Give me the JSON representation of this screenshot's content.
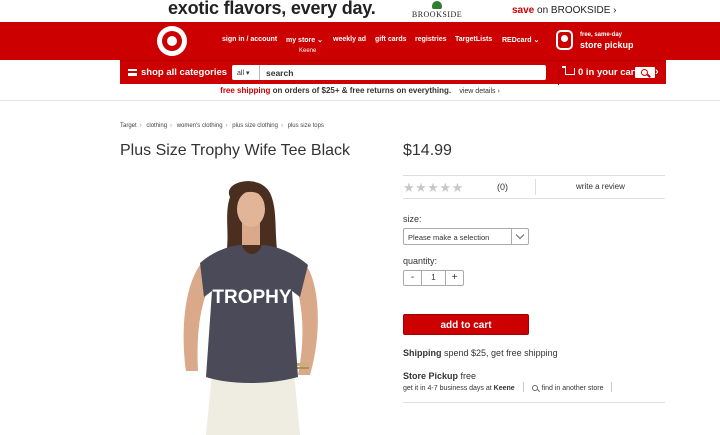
{
  "promo": {
    "tagline": "exotic flavors, every day.",
    "logo_text": "BROOKSIDE",
    "cta_save": "save",
    "cta_rest": "on BROOKSIDE ›"
  },
  "header": {
    "nav": [
      "sign in / account",
      "my store ⌄",
      "weekly ad",
      "gift cards",
      "registries",
      "TargetLists",
      "REDcard ⌄"
    ],
    "store_name": "Keene",
    "pickup_line1": "free, same-day",
    "pickup_line2": "store pickup"
  },
  "searchbar": {
    "shop_all": "shop all categories",
    "dept": "all ▾",
    "placeholder": "search",
    "cart": "0 in your cart",
    "cart_chevron": "›"
  },
  "shipping": {
    "free": "free shipping",
    "rest": "on orders of $25+ & free returns on everything.",
    "details": "view details ›"
  },
  "breadcrumb": [
    "Target",
    "clothing",
    "women's clothing",
    "plus size clothing",
    "plus size tops"
  ],
  "product": {
    "title": "Plus Size Trophy Wife Tee Black",
    "price": "$14.99",
    "stars": "★★★★★",
    "rating_value": 0,
    "rating_count": "(0)",
    "write_review": "write a review",
    "size_label": "size:",
    "size_placeholder": "Please make a selection",
    "quantity_label": "quantity:",
    "qty_minus": "-",
    "qty_value": "1",
    "qty_plus": "+",
    "add_to_cart": "add to cart",
    "shipping_bold": "Shipping",
    "shipping_text": "spend $25, get free shipping",
    "pickup_bold": "Store Pickup",
    "pickup_text": "free",
    "pickup_days": "get it in 4-7 business days at",
    "pickup_store": "Keene",
    "find_store": "find in another store",
    "shirt_text": "TROPHY"
  },
  "colors": {
    "brand_red": "#cc0000",
    "shirt": "#4a4a58",
    "pants": "#efece2"
  }
}
